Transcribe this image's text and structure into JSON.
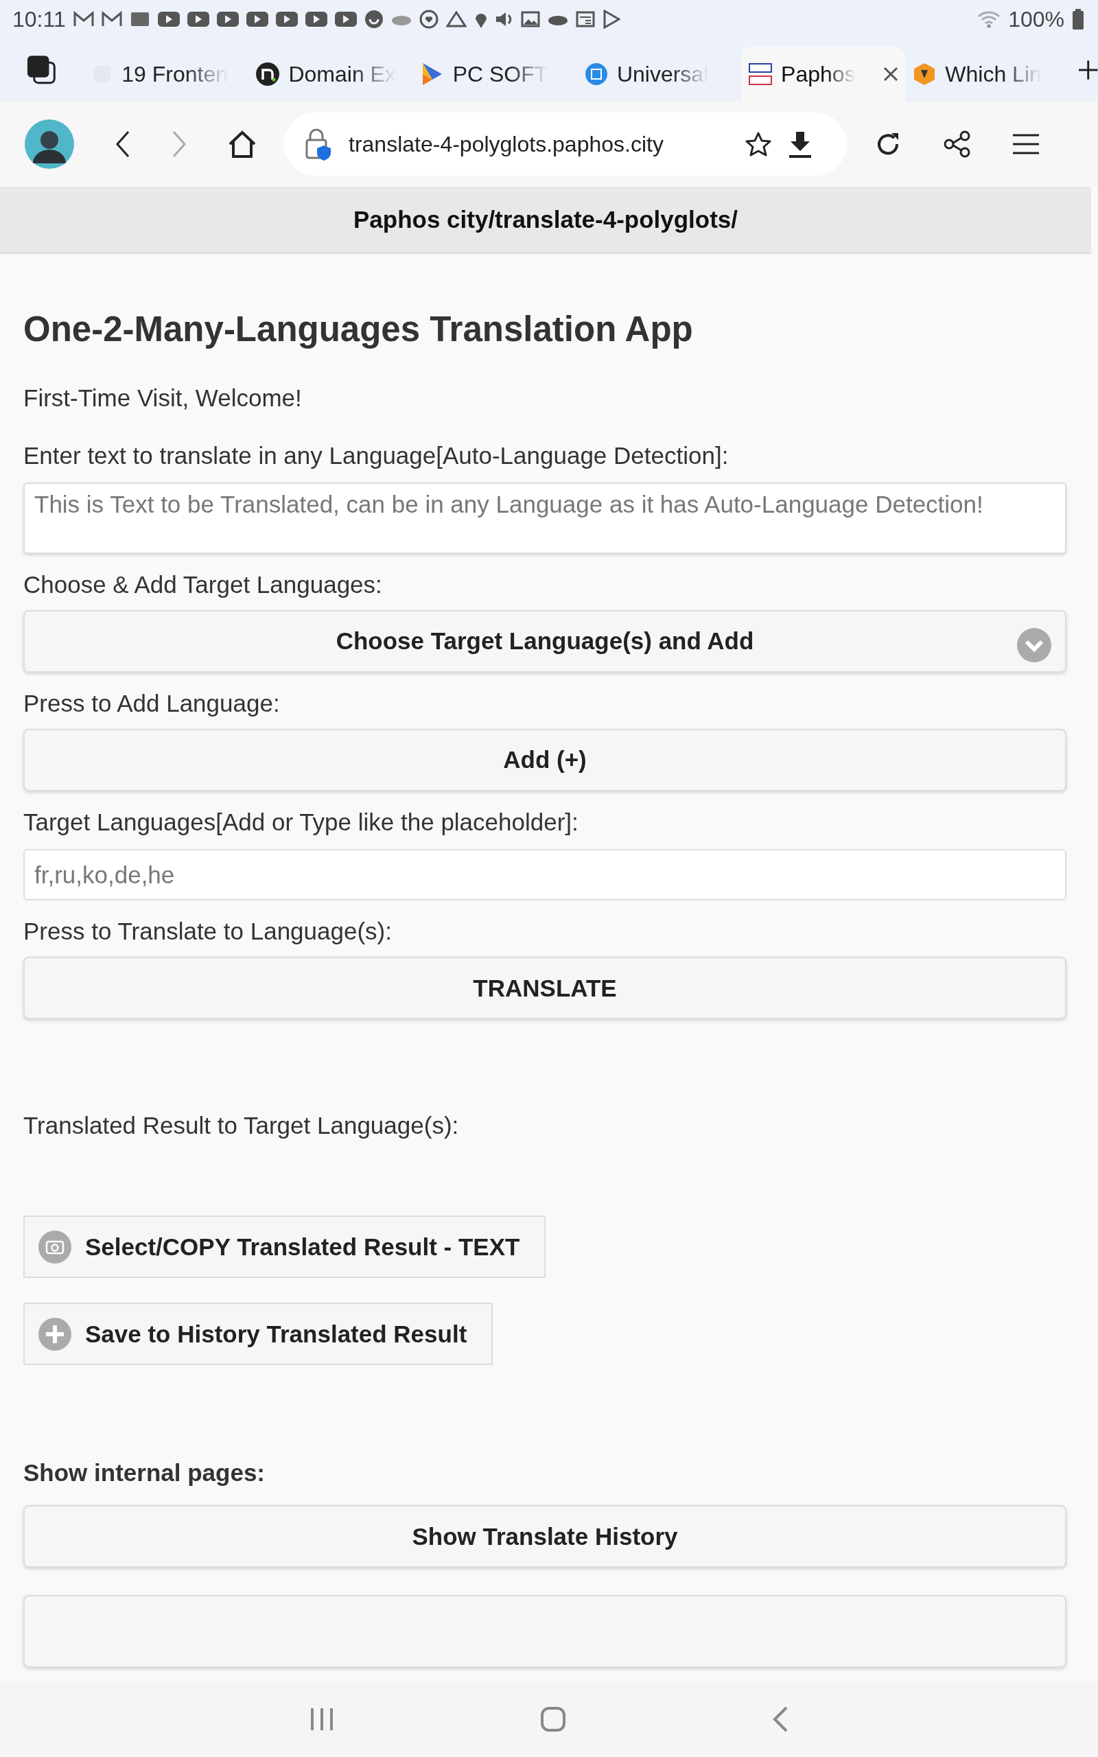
{
  "status_bar": {
    "time": "10:11",
    "battery": "100%"
  },
  "tabs": [
    {
      "label": "19 Fronten",
      "selected": false
    },
    {
      "label": "Domain Ex",
      "selected": false
    },
    {
      "label": "PC SOFT",
      "selected": false
    },
    {
      "label": "Universal",
      "selected": false
    },
    {
      "label": "Paphos",
      "selected": true
    },
    {
      "label": "Which Lin",
      "selected": false
    }
  ],
  "address_bar": {
    "url": "translate-4-polyglots.paphos.city"
  },
  "page_header": "Paphos city/translate-4-polyglots/",
  "page": {
    "title": "One-2-Many-Languages Translation App",
    "welcome": "First-Time Visit, Welcome!",
    "items": [
      {
        "kind": "label",
        "text": "Enter text to translate in any Language[Auto-Language Detection]:"
      },
      {
        "kind": "textarea",
        "placeholder": "This is Text to be Translated, can be in any Language as it has Auto-Language Detection!"
      },
      {
        "kind": "label",
        "text": "Choose & Add Target Languages:"
      },
      {
        "kind": "select",
        "text": "Choose Target Language(s) and Add"
      },
      {
        "kind": "label",
        "text": "Press to Add Language:"
      },
      {
        "kind": "button",
        "text": "Add (+)"
      },
      {
        "kind": "label",
        "text": "Target Languages[Add or Type like the placeholder]:"
      },
      {
        "kind": "input",
        "placeholder": "fr,ru,ko,de,he"
      },
      {
        "kind": "label",
        "text": "Press to Translate to Language(s):"
      },
      {
        "kind": "button",
        "text": "TRANSLATE"
      },
      {
        "kind": "result_label",
        "text": "Translated Result to Target Language(s):"
      },
      {
        "kind": "copy_button",
        "text": "Select/COPY Translated Result - TEXT"
      },
      {
        "kind": "save_button",
        "text": "Save to History Translated Result"
      },
      {
        "kind": "section",
        "text": "Show internal pages:"
      },
      {
        "kind": "button",
        "text": "Show Translate History"
      },
      {
        "kind": "cut_button"
      }
    ]
  }
}
